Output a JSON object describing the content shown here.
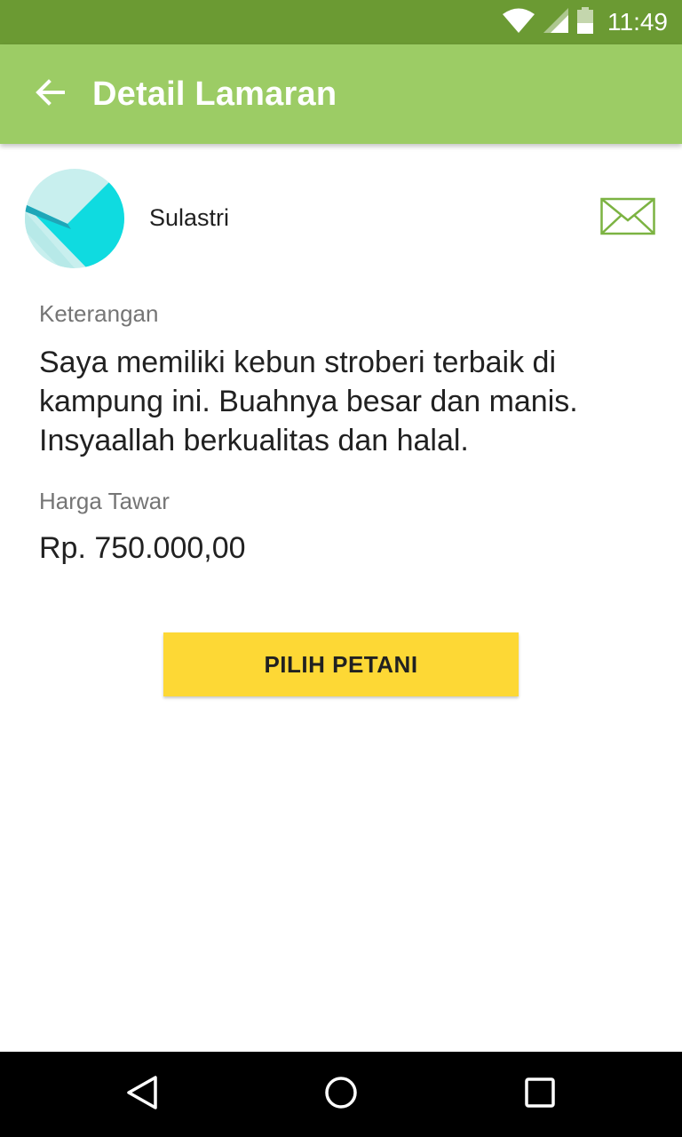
{
  "status_bar": {
    "time": "11:49",
    "icons": [
      "wifi-icon",
      "signal-icon",
      "battery-icon"
    ]
  },
  "app_bar": {
    "title": "Detail Lamaran",
    "back_icon": "arrow-back-icon"
  },
  "applicant": {
    "name": "Sulastri",
    "avatar_icon": "avatar-placeholder",
    "message_icon": "mail-icon"
  },
  "details": {
    "description_label": "Keterangan",
    "description": "Saya memiliki kebun stroberi terbaik di kampung ini. Buahnya besar dan manis. Insyaallah berkualitas dan halal.",
    "price_label": "Harga Tawar",
    "price": "Rp. 750.000,00"
  },
  "actions": {
    "select_farmer_label": "PILIH PETANI"
  },
  "nav_bar": {
    "icons": [
      "nav-back-icon",
      "nav-home-icon",
      "nav-recent-icon"
    ]
  },
  "colors": {
    "status_bar": "#6b9a33",
    "app_bar": "#9ccc65",
    "button": "#fdd835",
    "mail_icon": "#7cb342"
  }
}
